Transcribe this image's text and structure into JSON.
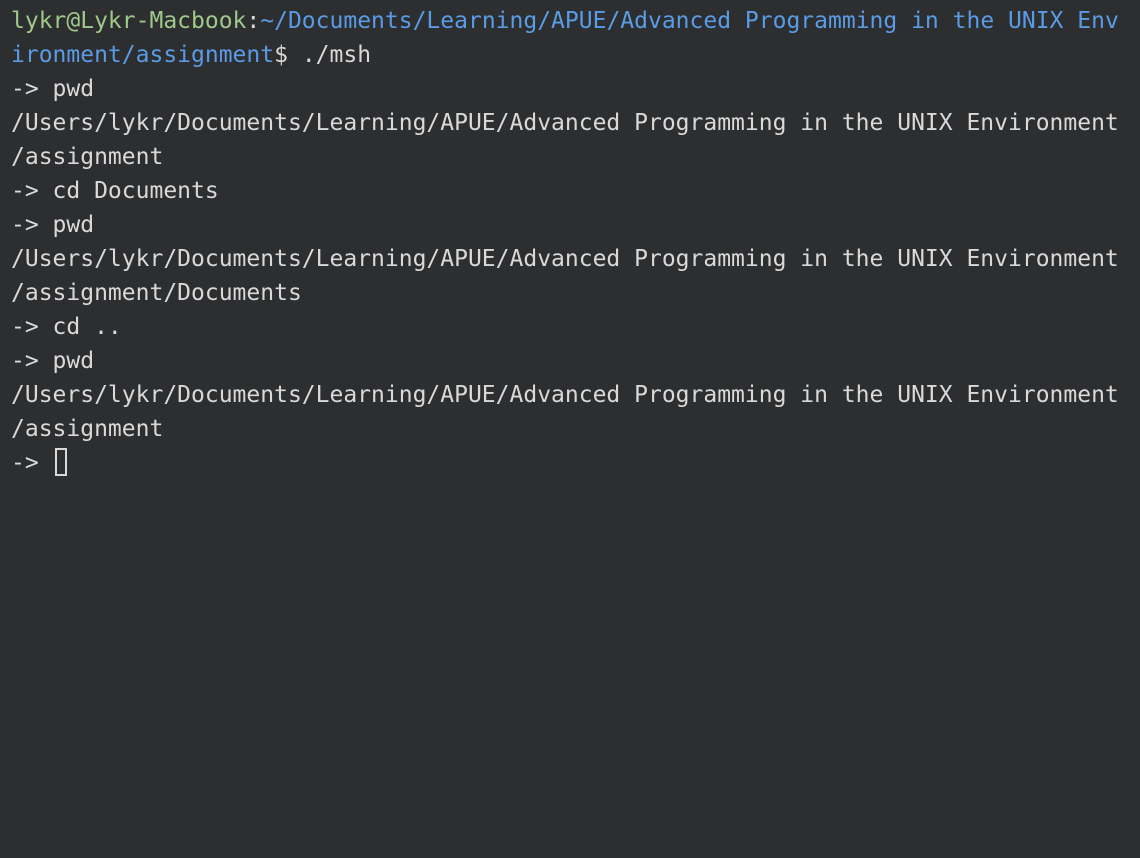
{
  "colors": {
    "background": "#2d2e30",
    "text": "#d9d9d9",
    "user_host": "#9fc98a",
    "path": "#5a9be6"
  },
  "prompt": {
    "user_host": "lykr@Lykr-Macbook",
    "colon": ":",
    "path_part1": "~/Documents/Learning/APUE/Advanced Programming in the UNIX Env",
    "path_part2": "ironment/assignment",
    "dollar": "$",
    "command": " ./msh"
  },
  "output_lines": [
    "-> pwd",
    "/Users/lykr/Documents/Learning/APUE/Advanced Programming in the UNIX Environment",
    "/assignment",
    "-> cd Documents",
    "-> pwd",
    "/Users/lykr/Documents/Learning/APUE/Advanced Programming in the UNIX Environment",
    "/assignment/Documents",
    "-> cd ..",
    "-> pwd",
    "/Users/lykr/Documents/Learning/APUE/Advanced Programming in the UNIX Environment",
    "/assignment"
  ],
  "current_prompt": "-> "
}
